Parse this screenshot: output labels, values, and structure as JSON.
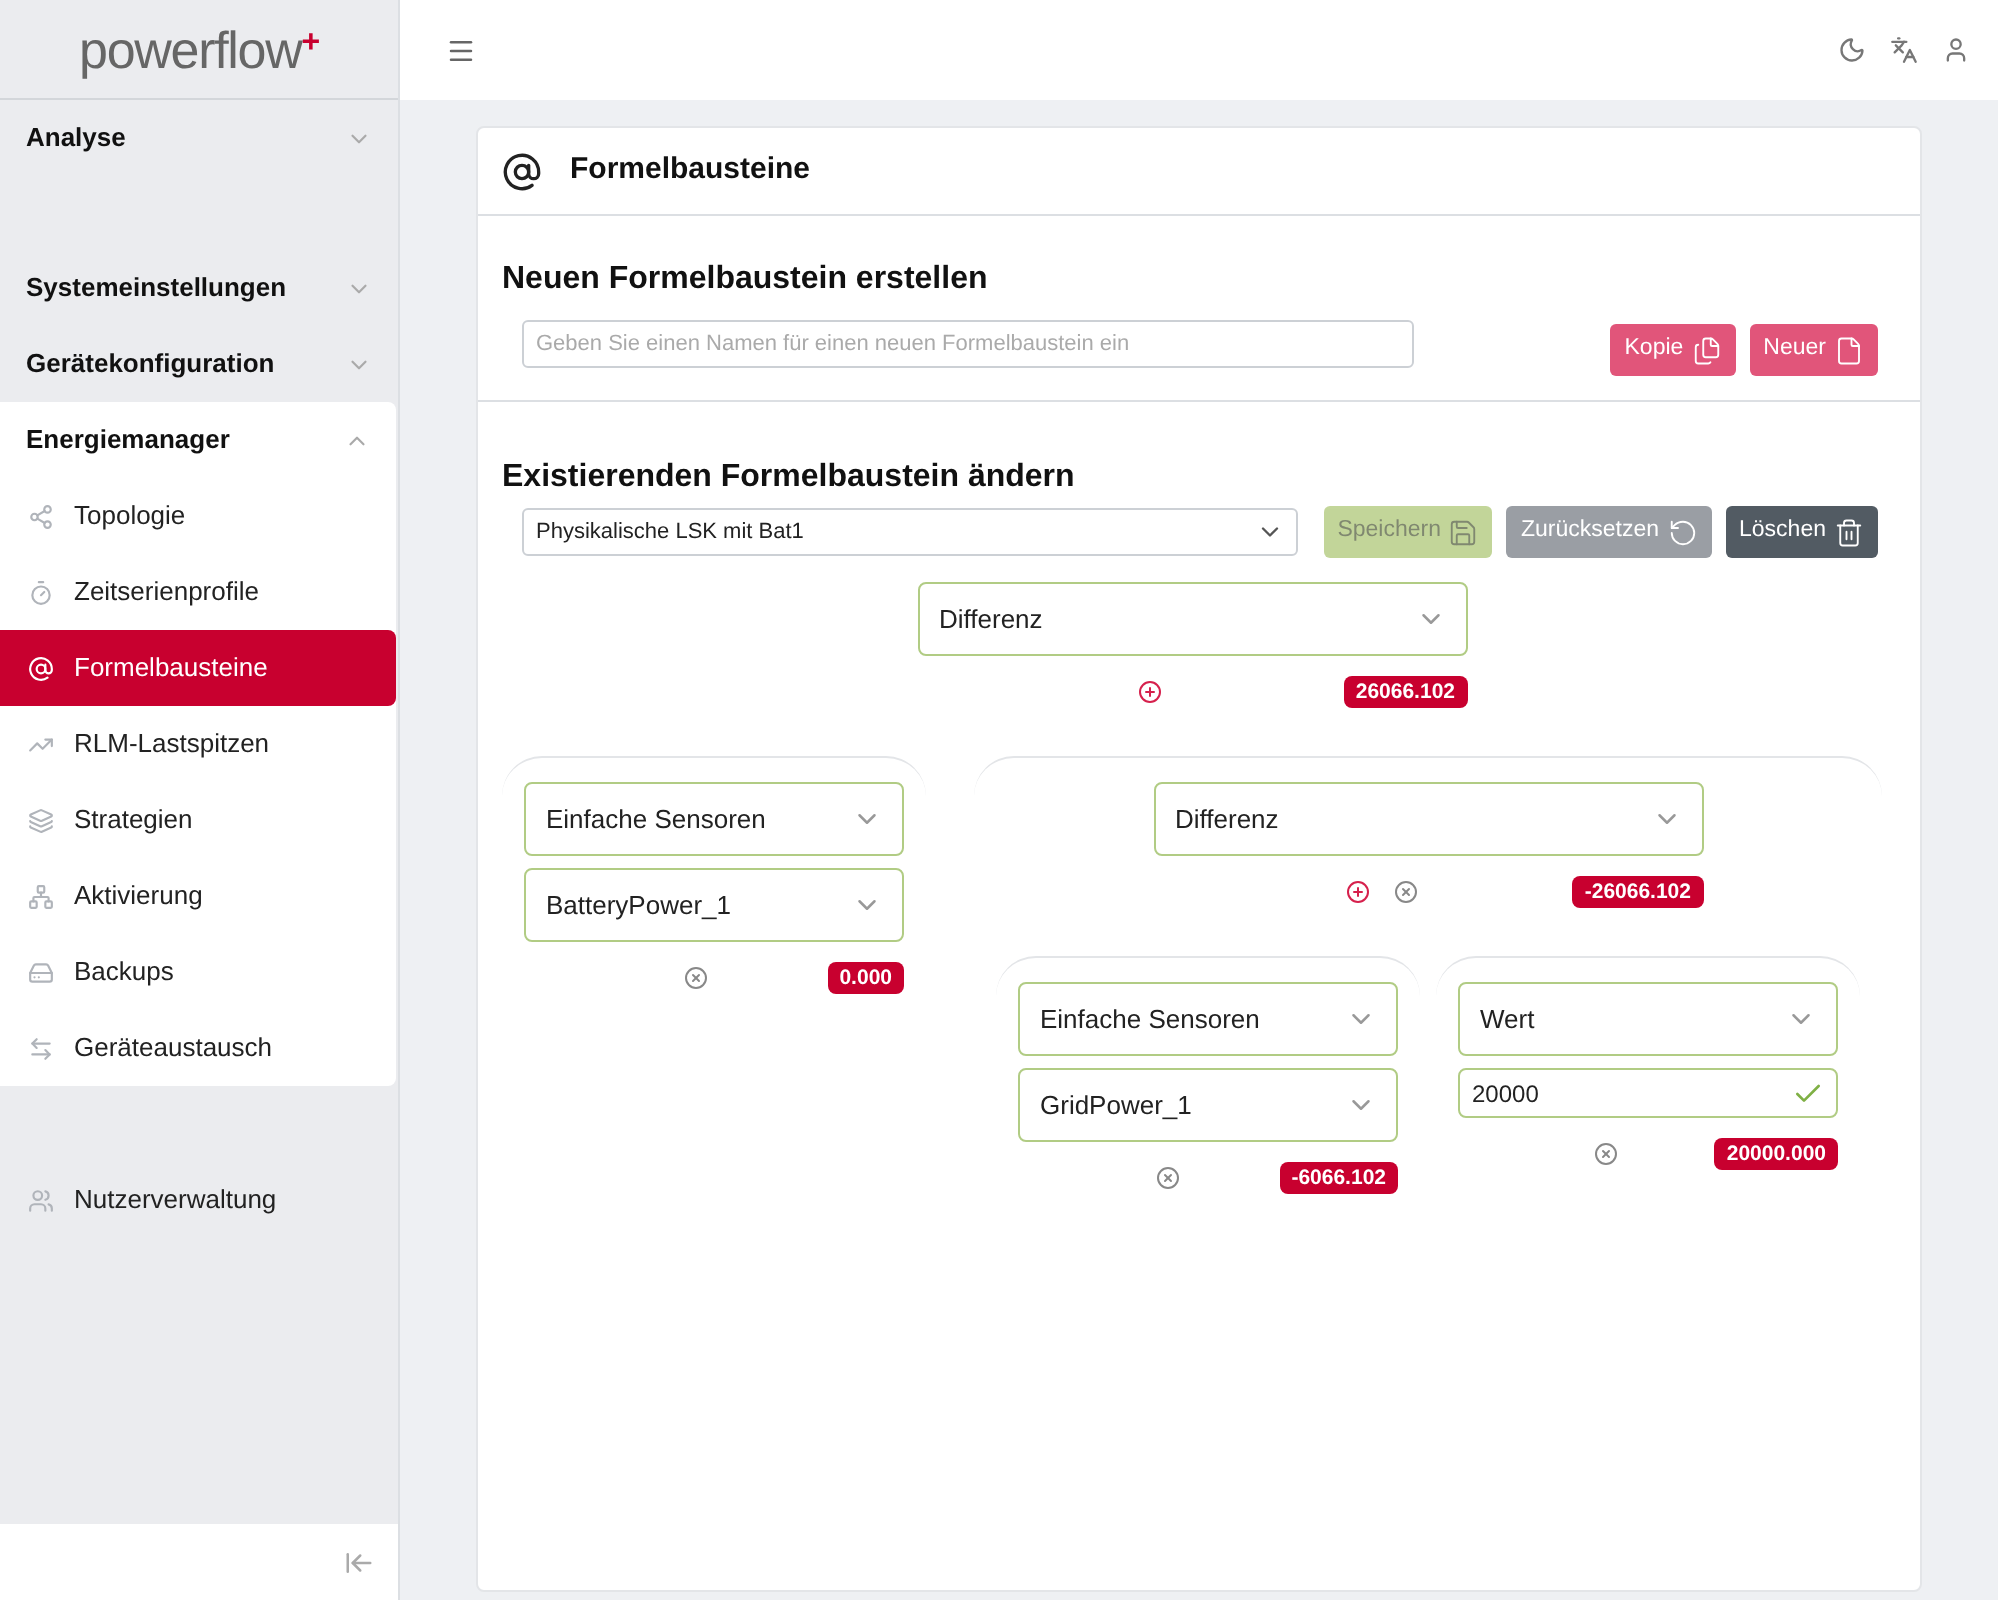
{
  "logo": {
    "text": "powerflow",
    "mark": "+"
  },
  "sidebar": {
    "sections": [
      {
        "label": "Analyse",
        "expanded": false
      },
      {
        "label": "Systemeinstellungen",
        "expanded": false
      },
      {
        "label": "Gerätekonfiguration",
        "expanded": false
      },
      {
        "label": "Energiemanager",
        "expanded": true,
        "items": [
          {
            "label": "Topologie",
            "selected": false
          },
          {
            "label": "Zeitserienprofile",
            "selected": false
          },
          {
            "label": "Formelbausteine",
            "selected": true
          },
          {
            "label": "RLM-Lastspitzen",
            "selected": false
          },
          {
            "label": "Strategien",
            "selected": false
          },
          {
            "label": "Aktivierung",
            "selected": false
          },
          {
            "label": "Backups",
            "selected": false
          },
          {
            "label": "Geräteaustausch",
            "selected": false
          }
        ]
      }
    ],
    "footer_items": [
      {
        "label": "Nutzerverwaltung",
        "selected": false
      }
    ]
  },
  "page": {
    "title": "Formelbausteine",
    "create": {
      "heading": "Neuen Formelbaustein erstellen",
      "placeholder": "Geben Sie einen Namen für einen neuen Formelbaustein ein",
      "buttons": [
        {
          "label": "Kopie",
          "kind": "copy",
          "disabled": false
        },
        {
          "label": "Neuer",
          "kind": "new",
          "disabled": false
        }
      ]
    },
    "edit": {
      "heading": "Existierenden Formelbaustein ändern",
      "selected_formula": "Physikalische LSK mit Bat1",
      "buttons": [
        {
          "label": "Speichern",
          "kind": "save",
          "disabled": true
        },
        {
          "label": "Zurücksetzen",
          "kind": "reset",
          "disabled": false
        },
        {
          "label": "Löschen",
          "kind": "delete",
          "disabled": false
        }
      ]
    },
    "tree": {
      "fields": [
        {
          "kind": "select",
          "value": "Differenz"
        }
      ],
      "can_add": true,
      "can_remove": false,
      "result": "26066.102",
      "children": [
        {
          "fields": [
            {
              "kind": "select",
              "value": "Einfache Sensoren"
            },
            {
              "kind": "select",
              "value": "BatteryPower_1"
            }
          ],
          "can_add": false,
          "can_remove": true,
          "result": "0.000"
        },
        {
          "fields": [
            {
              "kind": "select",
              "value": "Differenz"
            }
          ],
          "can_add": true,
          "can_remove": true,
          "result": "-26066.102",
          "children": [
            {
              "fields": [
                {
                  "kind": "select",
                  "value": "Einfache Sensoren"
                },
                {
                  "kind": "select",
                  "value": "GridPower_1"
                }
              ],
              "can_add": false,
              "can_remove": true,
              "result": "-6066.102"
            },
            {
              "fields": [
                {
                  "kind": "select",
                  "value": "Wert"
                },
                {
                  "kind": "input",
                  "value": "20000",
                  "valid": true
                }
              ],
              "can_add": false,
              "can_remove": true,
              "result": "20000.000"
            }
          ]
        }
      ]
    }
  }
}
